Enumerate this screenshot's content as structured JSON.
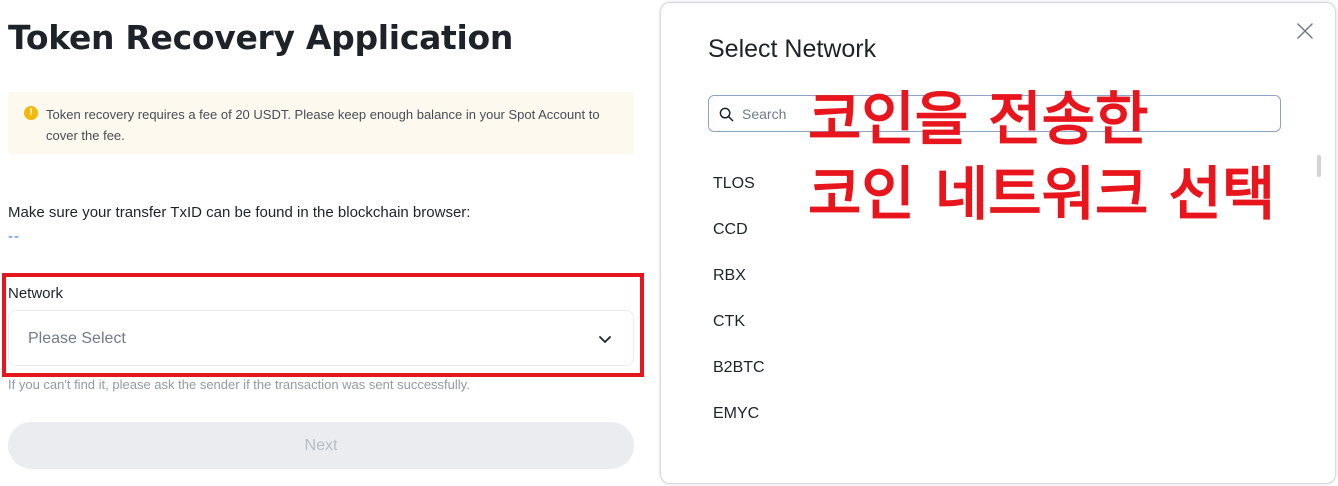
{
  "left": {
    "title": "Token Recovery Application",
    "notice": "Token recovery requires a fee of 20 USDT. Please keep enough balance in your Spot Account to cover the fee.",
    "txid_text": "Make sure your transfer TxID can be found in the blockchain browser:",
    "txid_value": "--",
    "network_label": "Network",
    "network_placeholder": "Please Select",
    "hint": "If you can't find it, please ask the sender if the transaction was sent successfully.",
    "next_label": "Next"
  },
  "modal": {
    "title": "Select Network",
    "search_placeholder": "Search",
    "networks": [
      "TLOS",
      "CCD",
      "RBX",
      "CTK",
      "B2BTC",
      "EMYC"
    ]
  },
  "overlay": {
    "line1": "코인을 전송한",
    "line2": "코인 네트워크 선택"
  },
  "colors": {
    "highlight": "#e4161e",
    "notice_bg": "#fef9ee",
    "warning_icon": "#f0b90b",
    "overlay_text": "#e8151d"
  }
}
